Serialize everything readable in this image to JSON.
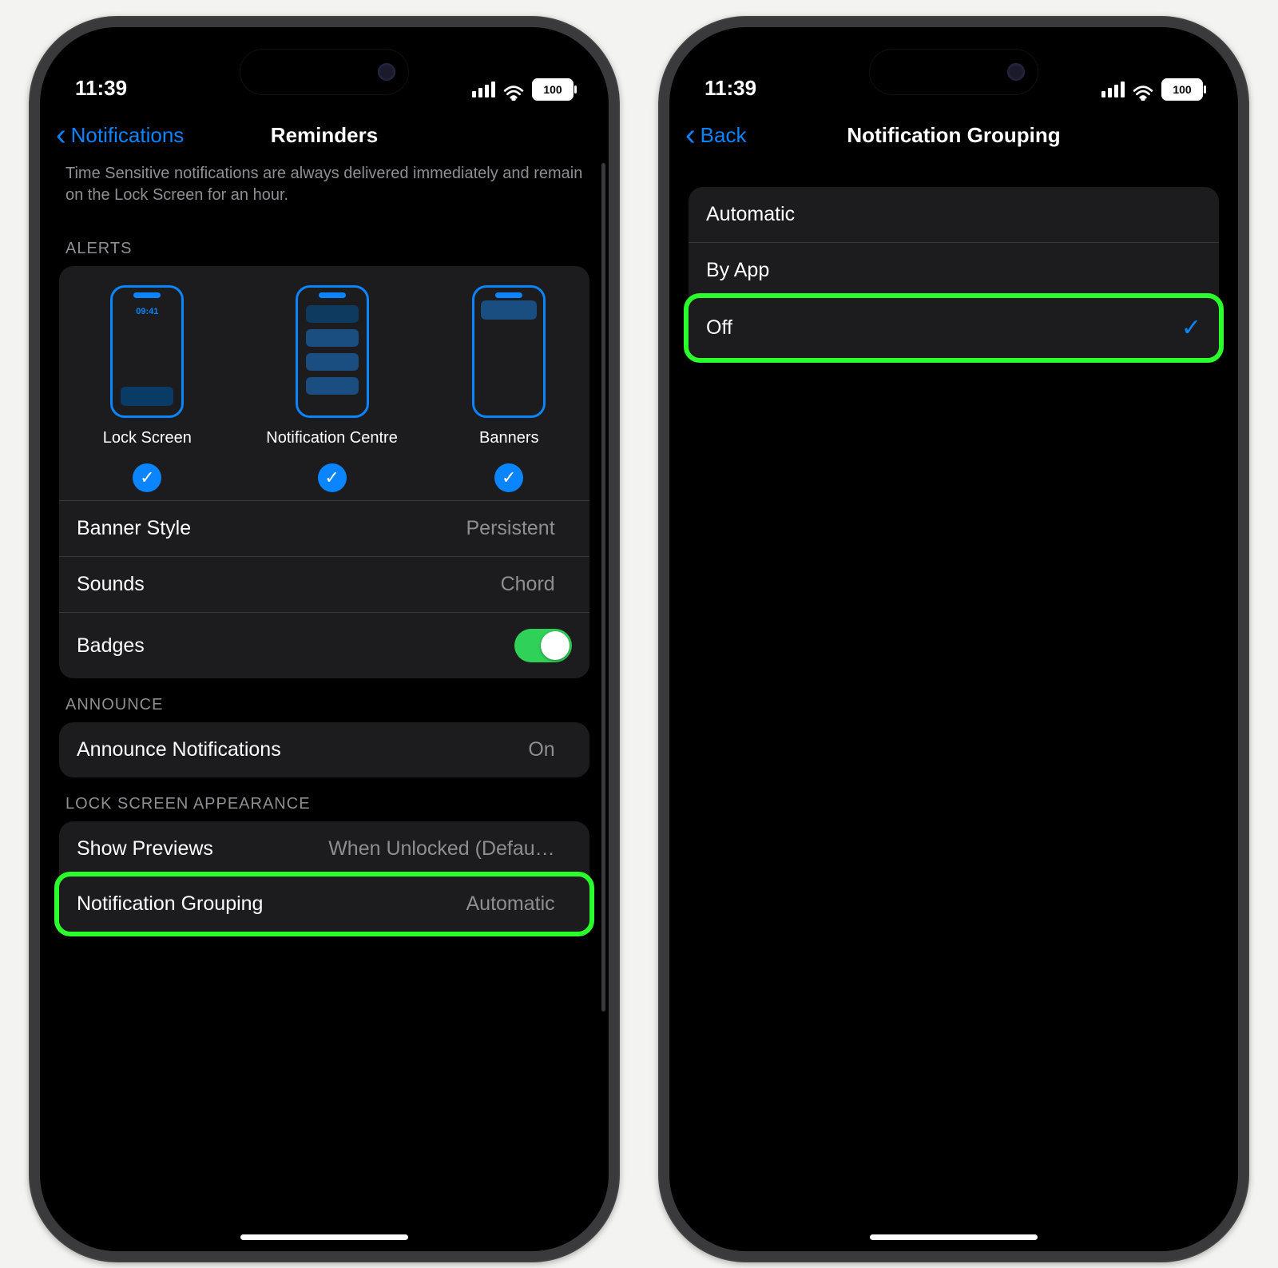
{
  "status": {
    "time": "11:39",
    "battery": "100"
  },
  "left": {
    "nav": {
      "back": "Notifications",
      "title": "Reminders"
    },
    "hint": "Time Sensitive notifications are always delivered immediately and remain on the Lock Screen for an hour.",
    "sections": {
      "alerts_header": "ALERTS",
      "alerts": {
        "lock": {
          "label": "Lock Screen",
          "time": "09:41"
        },
        "centre": {
          "label": "Notification Centre"
        },
        "banner": {
          "label": "Banners"
        }
      },
      "banner_style": {
        "label": "Banner Style",
        "value": "Persistent"
      },
      "sounds": {
        "label": "Sounds",
        "value": "Chord"
      },
      "badges": {
        "label": "Badges",
        "on": true
      },
      "announce_header": "ANNOUNCE",
      "announce": {
        "label": "Announce Notifications",
        "value": "On"
      },
      "ls_header": "LOCK SCREEN APPEARANCE",
      "previews": {
        "label": "Show Previews",
        "value": "When Unlocked (Defau…"
      },
      "grouping": {
        "label": "Notification Grouping",
        "value": "Automatic"
      }
    }
  },
  "right": {
    "nav": {
      "back": "Back",
      "title": "Notification Grouping"
    },
    "options": [
      {
        "label": "Automatic",
        "selected": false
      },
      {
        "label": "By App",
        "selected": false
      },
      {
        "label": "Off",
        "selected": true,
        "highlight": true
      }
    ]
  }
}
